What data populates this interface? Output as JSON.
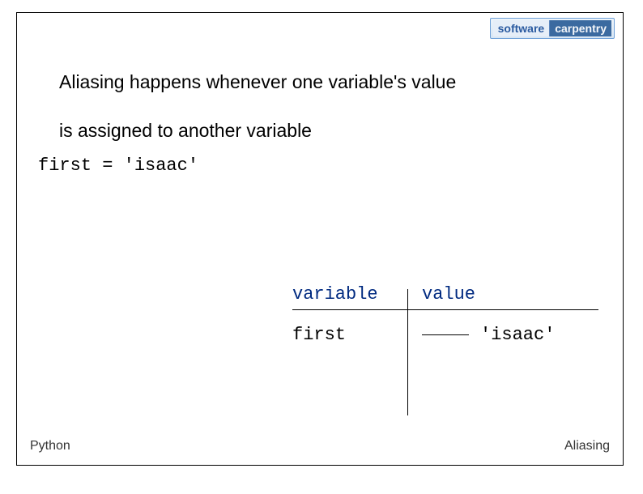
{
  "logo": {
    "left": "software",
    "right": "carpentry"
  },
  "main": {
    "line1": "Aliasing happens whenever one variable's value",
    "line2": "is assigned to another variable"
  },
  "code": "first = 'isaac'",
  "table": {
    "header_variable": "variable",
    "header_value": "value",
    "row1_name": "first",
    "row1_value": "'isaac'"
  },
  "footer": {
    "left": "Python",
    "right": "Aliasing"
  }
}
